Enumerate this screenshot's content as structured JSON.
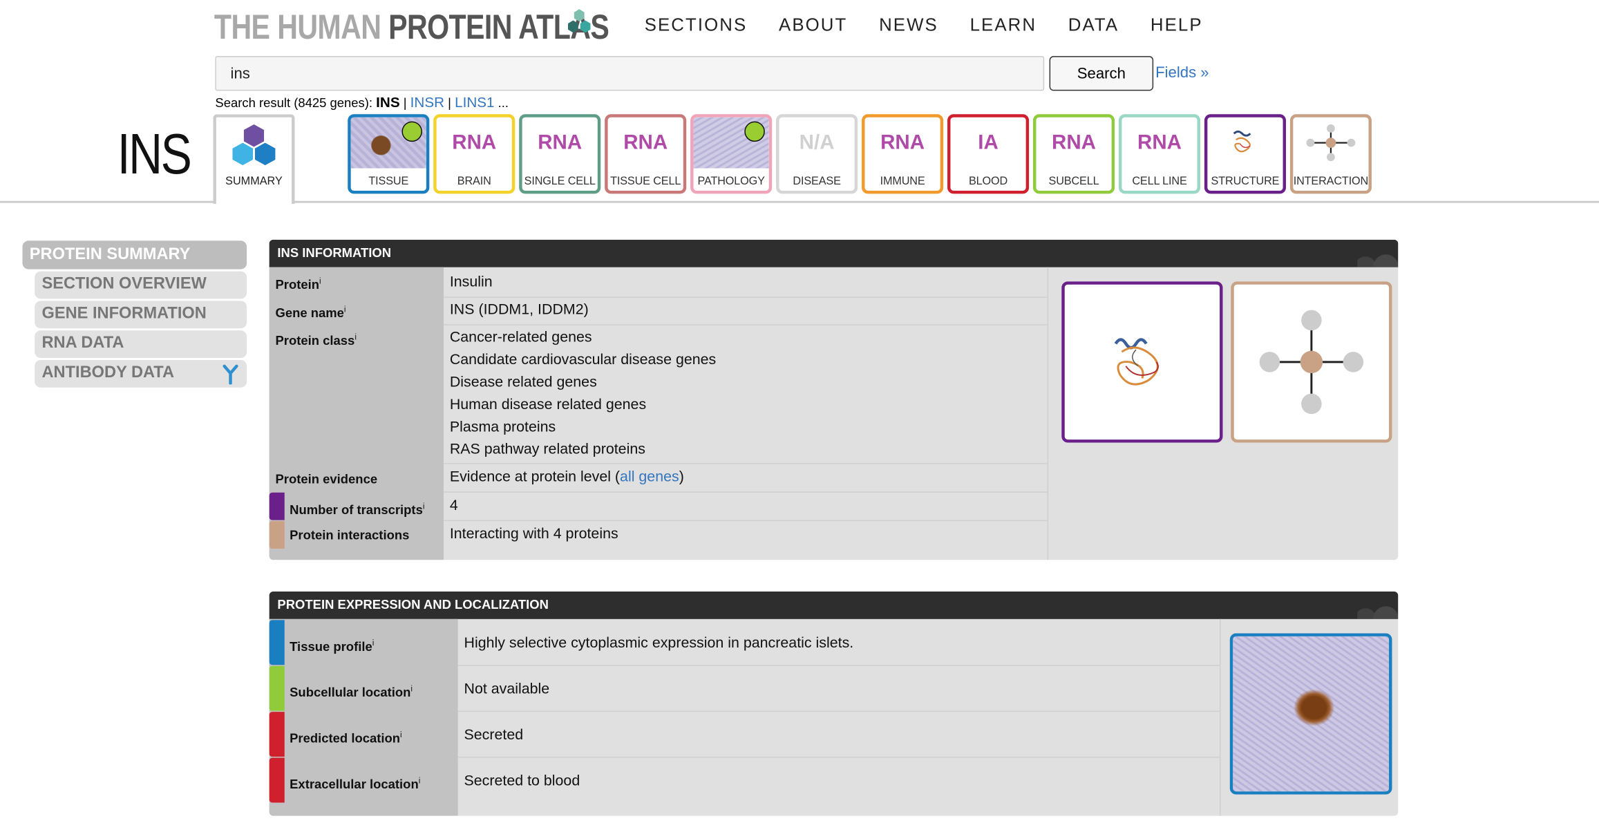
{
  "header": {
    "logo_part1": "THE HUMAN ",
    "logo_part2": "PROTEIN ATLAS",
    "nav": [
      "SECTIONS",
      "ABOUT",
      "NEWS",
      "LEARN",
      "DATA",
      "HELP"
    ]
  },
  "search": {
    "value": "ins",
    "button": "Search",
    "fields_link": "Fields »",
    "result_prefix": "Search result (8425 genes): ",
    "result_current": "INS",
    "result_sep": " | ",
    "results": [
      "INSR",
      "LINS1"
    ],
    "result_more": " ..."
  },
  "gene": {
    "symbol": "INS"
  },
  "tabs": {
    "summary": "SUMMARY",
    "items": [
      {
        "label": "TISSUE",
        "top": "",
        "color": "#1a7fc1",
        "text_color": "#1a7fc1",
        "dot": true
      },
      {
        "label": "BRAIN",
        "top": "RNA",
        "color": "#f3d22b",
        "text_color": "#b04aa8",
        "dot": false
      },
      {
        "label": "SINGLE CELL",
        "top": "RNA",
        "color": "#5f9e86",
        "text_color": "#b04aa8",
        "dot": false
      },
      {
        "label": "TISSUE CELL",
        "top": "RNA",
        "color": "#c97777",
        "text_color": "#b04aa8",
        "dot": false
      },
      {
        "label": "PATHOLOGY",
        "top": "",
        "color": "#f0a4b9",
        "text_color": "#b04aa8",
        "dot": true
      },
      {
        "label": "DISEASE",
        "top": "N/A",
        "color": "#d6d6d6",
        "text_color": "#d0d0d0",
        "dot": false
      },
      {
        "label": "IMMUNE",
        "top": "RNA",
        "color": "#f39a2c",
        "text_color": "#b04aa8",
        "dot": false
      },
      {
        "label": "BLOOD",
        "top": "IA",
        "color": "#d0202e",
        "text_color": "#b04aa8",
        "dot": false
      },
      {
        "label": "SUBCELL",
        "top": "RNA",
        "color": "#8fcb3b",
        "text_color": "#b04aa8",
        "dot": false
      },
      {
        "label": "CELL LINE",
        "top": "RNA",
        "color": "#9ad8c6",
        "text_color": "#b04aa8",
        "dot": false
      },
      {
        "label": "STRUCTURE",
        "top": "",
        "color": "#6a1f8a",
        "text_color": "#b04aa8",
        "dot": false
      },
      {
        "label": "INTERACTION",
        "top": "",
        "color": "#c9a286",
        "text_color": "#b04aa8",
        "dot": false
      }
    ]
  },
  "sidebar": {
    "main": "PROTEIN SUMMARY",
    "items": [
      "SECTION OVERVIEW",
      "GENE INFORMATION",
      "RNA DATA",
      "ANTIBODY DATA"
    ]
  },
  "info_panel": {
    "title": "INS INFORMATION",
    "rows": {
      "protein": {
        "label": "Protein",
        "value": "Insulin"
      },
      "gene_name": {
        "label": "Gene name",
        "value": "INS (IDDM1, IDDM2)"
      },
      "protein_class": {
        "label": "Protein class",
        "values": [
          "Cancer-related genes",
          "Candidate cardiovascular disease genes",
          "Disease related genes",
          "Human disease related genes",
          "Plasma proteins",
          "RAS pathway related proteins"
        ]
      },
      "protein_evidence": {
        "label": "Protein evidence",
        "value": "Evidence at protein level (",
        "link": "all genes",
        "suffix": ")"
      },
      "transcripts": {
        "label": "Number of transcripts",
        "value": "4",
        "color": "#6a1f8a"
      },
      "interactions": {
        "label": "Protein interactions",
        "value": "Interacting with 4 proteins",
        "color": "#c9a286"
      }
    },
    "info_mark": "i"
  },
  "expr_panel": {
    "title": "PROTEIN EXPRESSION AND LOCALIZATION",
    "rows": [
      {
        "label": "Tissue profile",
        "value": "Highly selective cytoplasmic expression in pancreatic islets.",
        "color": "#1a7fc1"
      },
      {
        "label": "Subcellular location",
        "value": "Not available",
        "color": "#8fcb3b"
      },
      {
        "label": "Predicted location",
        "value": "Secreted",
        "color": "#d0202e"
      },
      {
        "label": "Extracellular location",
        "value": "Secreted to blood",
        "color": "#d0202e"
      }
    ]
  }
}
